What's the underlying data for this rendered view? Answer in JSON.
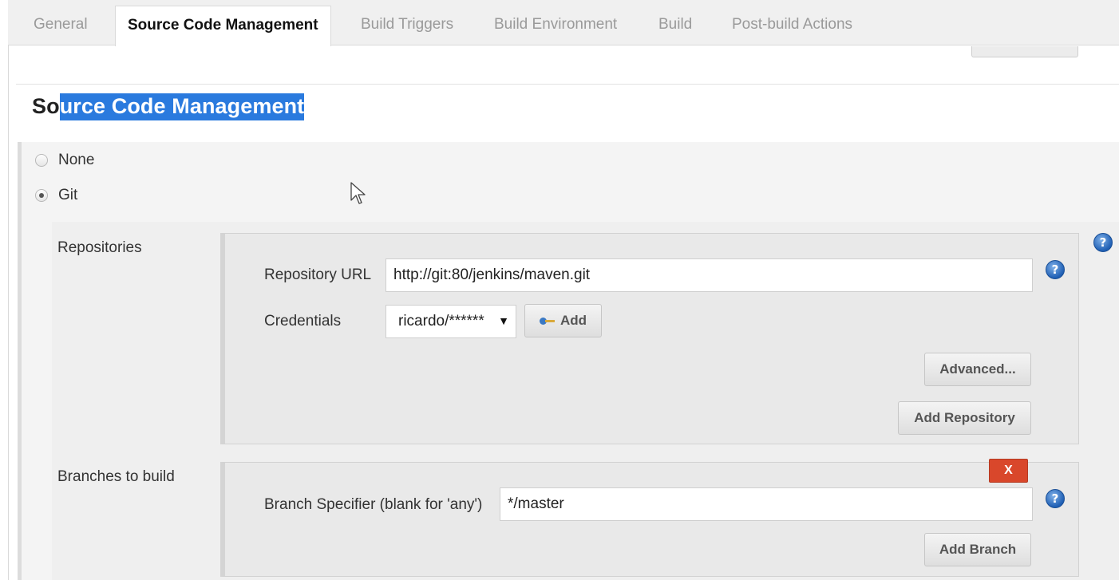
{
  "tabs": [
    {
      "label": "General",
      "active": false
    },
    {
      "label": "Source Code Management",
      "active": true
    },
    {
      "label": "Build Triggers",
      "active": false
    },
    {
      "label": "Build Environment",
      "active": false
    },
    {
      "label": "Build",
      "active": false
    },
    {
      "label": "Post-build Actions",
      "active": false
    }
  ],
  "section": {
    "title_unselected": "So",
    "title_selected": "urce Code Management"
  },
  "scm": {
    "options": [
      {
        "label": "None",
        "checked": false
      },
      {
        "label": "Git",
        "checked": true
      }
    ]
  },
  "repositories": {
    "label": "Repositories",
    "url_label": "Repository URL",
    "url_value": "http://git:80/jenkins/maven.git",
    "credentials_label": "Credentials",
    "credentials_selected": "ricardo/******",
    "add_button": "Add",
    "advanced_button": "Advanced...",
    "add_repository_button": "Add Repository"
  },
  "branches": {
    "label": "Branches to build",
    "specifier_label": "Branch Specifier (blank for 'any')",
    "specifier_value": "*/master",
    "delete_button": "X",
    "add_branch_button": "Add Branch"
  },
  "icons": {
    "help": "help-icon",
    "key": "key-icon",
    "caret": "caret-down-icon",
    "cursor": "mouse-pointer-icon"
  },
  "colors": {
    "selection": "#2a7ade",
    "delete": "#d9472b",
    "help": "#1f5fb4"
  }
}
